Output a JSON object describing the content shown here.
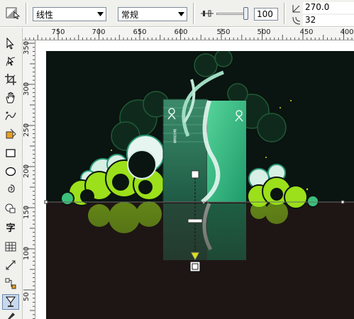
{
  "property_bar": {
    "transparency_type": "线性",
    "merge_mode": "常规",
    "transparency_value": "100",
    "angle": "270.0",
    "border": "32"
  },
  "rulers": {
    "horizontal_labels": [
      "750",
      "700",
      "650",
      "600",
      "550",
      "500",
      "450",
      "400"
    ],
    "vertical_labels": [
      "350",
      "300",
      "250",
      "200",
      "150",
      "100",
      "50"
    ]
  },
  "toolbox": {
    "text_tool_label": "字",
    "tools": [
      "pick-tool",
      "shape-tool",
      "crop-tool",
      "pan-tool",
      "freehand-tool",
      "smart-fill-tool",
      "rectangle-tool",
      "ellipse-tool",
      "spiral-tool",
      "basic-shapes-tool",
      "text-tool",
      "table-tool",
      "dimension-tool",
      "connector-tool",
      "transparency-tool"
    ]
  },
  "artwork": {
    "box_caption": "蒙古奇香",
    "colors": {
      "background_dark": "#0a1410",
      "floor": "#1e1614",
      "lime": "#9be01a",
      "green": "#3cbf7a",
      "teal": "#2a9a78",
      "handle_yellow": "#d8e020"
    }
  }
}
